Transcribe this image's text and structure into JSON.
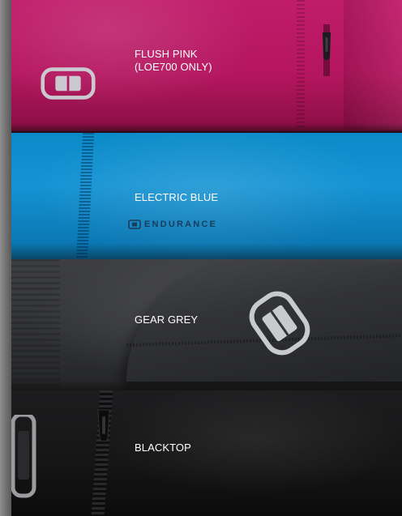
{
  "swatches": [
    {
      "id": "pink",
      "label_line1": "FLUSH PINK",
      "label_line2": "(LOE700 ONLY)",
      "color": "#c01c6a"
    },
    {
      "id": "blue",
      "label": "ELECTRIC BLUE",
      "color": "#0b8ac8"
    },
    {
      "id": "grey",
      "label": "GEAR GREY",
      "color": "#333437"
    },
    {
      "id": "black",
      "label": "BLACKTOP",
      "color": "#151516"
    }
  ],
  "brand": {
    "wordmark": "ENDURANCE",
    "icon": "ogio-logo-icon"
  },
  "icons": [
    "ogio-logo-icon",
    "zipper-pull-icon"
  ]
}
